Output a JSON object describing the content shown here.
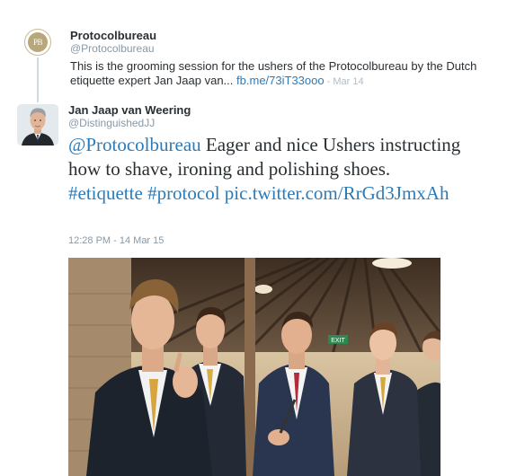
{
  "parent_tweet": {
    "avatar_text": "PB",
    "name": "Protocolbureau",
    "handle": "@Protocolbureau",
    "text": "This is the grooming session for the ushers of the Protocolbureau by the Dutch etiquette expert Jan Jaap van...",
    "link": "fb.me/73iT33ooo",
    "separator": " - ",
    "date": "Mar 14"
  },
  "main_tweet": {
    "name": "Jan Jaap van Weering",
    "handle": "@DistinguishedJJ",
    "mention": "@Protocolbureau",
    "text": " Eager and nice Ushers instructing how to shave, ironing and polishing shoes. ",
    "hashtag1": "#etiquette",
    "hashtag2": "#protocol",
    "pic_link": "pic.twitter.com/RrGd3JmxAh",
    "timestamp": "12:28 PM - 14 Mar 15",
    "exit_sign": "EXIT"
  },
  "colors": {
    "link": "#2b7bb9",
    "text": "#292f33",
    "secondary": "#8899a6",
    "thread_line": "#cfd9de"
  }
}
